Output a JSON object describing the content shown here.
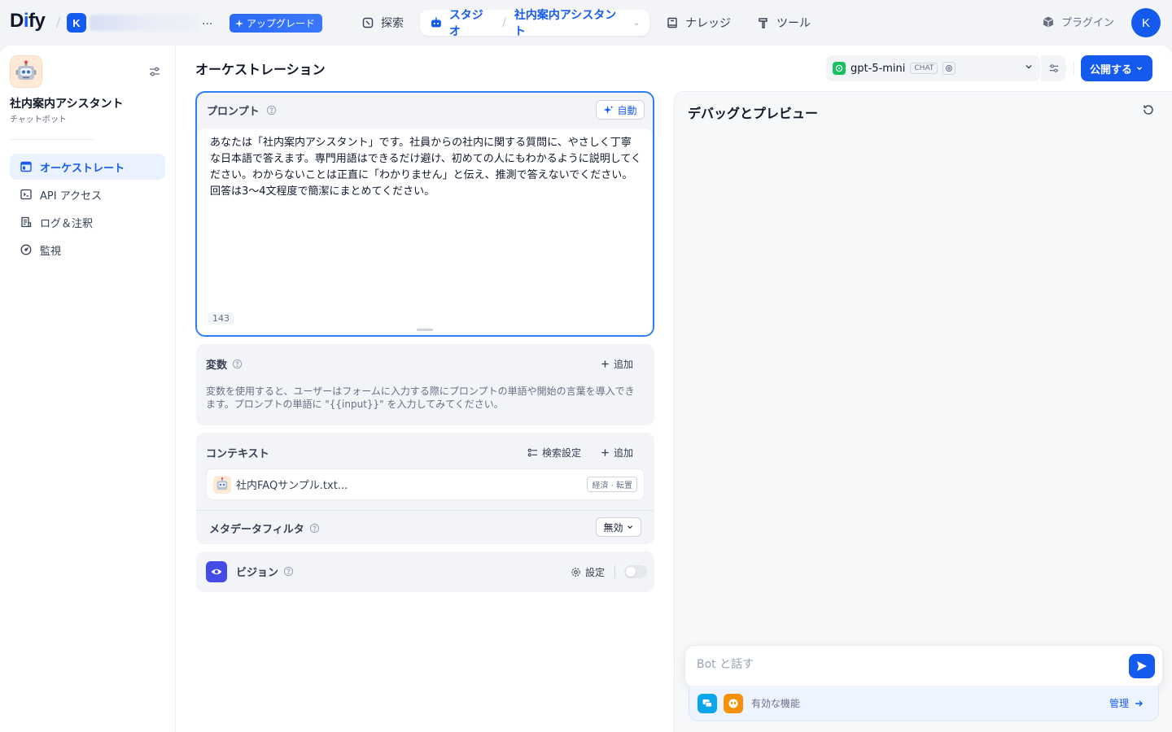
{
  "topbar": {
    "logo": "Dify",
    "workspace_initial": "K",
    "workspace_more": "...",
    "upgrade_label": "アップグレード",
    "nav": {
      "explore": "探索",
      "studio": "スタジオ",
      "current_app": "社内案内アシスタント",
      "knowledge": "ナレッジ",
      "tools": "ツール"
    },
    "plugins_label": "プラグイン",
    "avatar_initial": "K"
  },
  "sidebar": {
    "app_name": "社内案内アシスタント",
    "app_type": "チャットボット",
    "items": [
      {
        "label": "オーケストレート",
        "icon": "layout-icon",
        "active": true
      },
      {
        "label": "API アクセス",
        "icon": "terminal-icon",
        "active": false
      },
      {
        "label": "ログ＆注釈",
        "icon": "file-list-icon",
        "active": false
      },
      {
        "label": "監視",
        "icon": "dashboard-icon",
        "active": false
      }
    ]
  },
  "orchestration": {
    "title": "オーケストレーション",
    "model": {
      "name": "gpt-5-mini",
      "mode": "CHAT"
    },
    "publish_label": "公開する",
    "prompt": {
      "label": "プロンプト",
      "auto_label": "自動",
      "text": "あなたは「社内案内アシスタント」です。社員からの社内に関する質問に、やさしく丁寧な日本語で答えます。専門用語はできるだけ避け、初めての人にもわかるように説明してください。わからないことは正直に「わかりません」と伝え、推測で答えないでください。回答は3〜4文程度で簡潔にまとめてください。",
      "char_count": "143"
    },
    "variables": {
      "label": "変数",
      "add_label": "追加",
      "description": "変数を使用すると、ユーザーはフォームに入力する際にプロンプトの単語や開始の言葉を導入できます。プロンプトの単語に \"{{input}}\" を入力してみてください。"
    },
    "context": {
      "label": "コンテキスト",
      "retrieval_label": "検索設定",
      "add_label": "追加",
      "item_name": "社内FAQサンプル.txt...",
      "item_tag": "経済 · 転置",
      "metadata_label": "メタデータフィルタ",
      "metadata_value": "無効"
    },
    "vision": {
      "label": "ビジョン",
      "settings_label": "設定",
      "enabled": false
    }
  },
  "debug": {
    "title": "デバッグとプレビュー",
    "input_placeholder": "Bot と話す",
    "features_label": "有効な機能",
    "manage_label": "管理"
  },
  "colors": {
    "primary": "#155aef",
    "prompt_border": "#2c7ff5",
    "vision_icon": "#444ce7",
    "feature_chat": "#0ba5ec",
    "feature_quote": "#f79009"
  }
}
